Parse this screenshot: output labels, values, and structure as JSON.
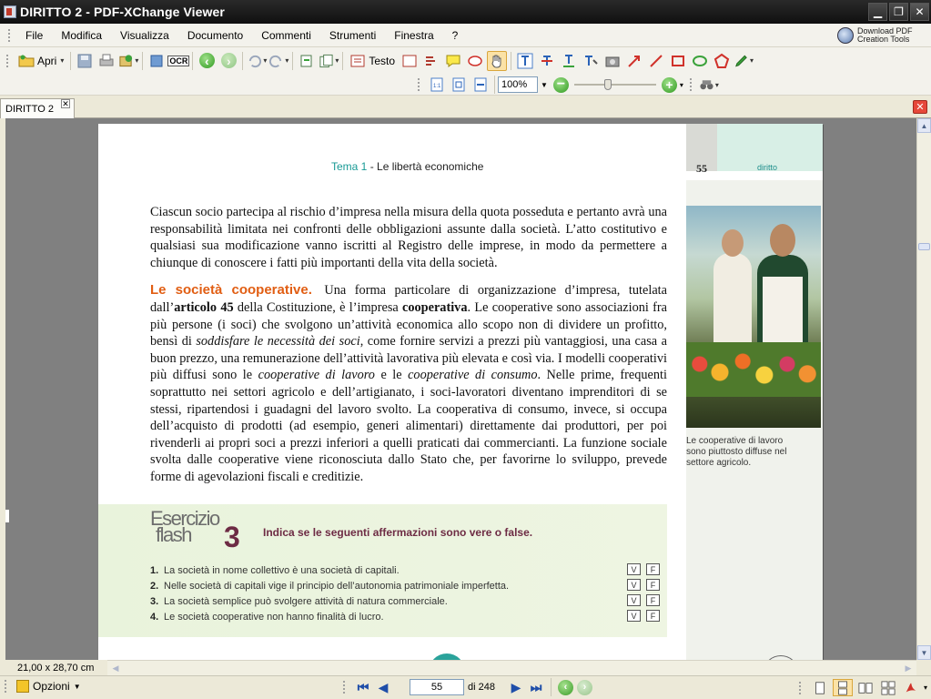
{
  "window": {
    "title": "DIRITTO 2 - PDF-XChange Viewer",
    "minimize": "▁",
    "restore": "❐",
    "close": "✕"
  },
  "menu": {
    "items": [
      "File",
      "Modifica",
      "Visualizza",
      "Documento",
      "Commenti",
      "Strumenti",
      "Finestra",
      "?"
    ]
  },
  "download": {
    "line1": "Download PDF",
    "line2": "Creation Tools"
  },
  "toolbar": {
    "open_label": "Apri",
    "ocr_label": "OCR",
    "text_label": "Testo",
    "zoom_value": "100%"
  },
  "tab": {
    "label": "DIRITTO 2",
    "close": "✕"
  },
  "page": {
    "header_tema": "Tema 1",
    "header_rest": " - Le libertà economiche",
    "page_number": "55",
    "section": "diritto",
    "para1": "Ciascun socio partecipa al rischio d’impresa nella misura della quota posseduta e pertanto avrà una responsabilità limitata nei confronti delle obbligazioni assunte dalla società. L’atto costitutivo e qualsiasi sua modificazione vanno iscritti al Registro delle imprese, in modo da permettere a chiunque di conoscere i fatti più importanti della vita della società.",
    "subhead": "Le società cooperative.",
    "para2_a": "Una forma particolare di organizzazione d’impresa, tutelata dall’",
    "para2_b": "articolo 45",
    "para2_c": " della Costituzione, è l’impresa ",
    "para2_d": "cooperativa",
    "para2_e": ". Le cooperative sono associazioni fra più persone (i soci) che svolgono un’attività economica allo scopo non di dividere un profitto, bensì di ",
    "para2_f": "soddisfare le necessità dei soci",
    "para2_g": ", come fornire servizi a prezzi più vantaggiosi, una casa a buon prezzo, una remunerazione dell’attività lavorativa più elevata e così via. I modelli cooperativi più diffusi sono le ",
    "para2_h": "cooperative di lavoro",
    "para2_i": " e le ",
    "para2_j": "cooperative di consumo",
    "para2_k": ". Nelle prime, frequenti soprattutto nei settori agricolo e dell’artigianato, i soci-lavoratori diventano imprenditori di se stessi, ripartendosi i guadagni del lavoro svolto. La cooperativa di consumo, invece, si occupa dell’acquisto di prodotti (ad esempio, generi alimentari) direttamente dai produttori, per poi rivenderli ai propri soci a prezzi inferiori a quelli praticati dai commercianti. La funzione sociale svolta dalle cooperative viene riconosciuta dallo Stato che, per favorirne lo sviluppo, prevede forme di agevolazioni fiscali e creditizie.",
    "caption": "Le cooperative di lavoro sono piuttosto diffuse nel settore agricolo.",
    "exercise": {
      "title1": "Esercizio",
      "title2": "flash",
      "number": "3",
      "instruction": "Indica se le seguenti affermazioni sono vere o false.",
      "v": "V",
      "f": "F",
      "items": [
        {
          "n": "1.",
          "text": "La società in nome collettivo è una società di capitali."
        },
        {
          "n": "2.",
          "text": "Nelle società di capitali vige il principio dell’autonomia patrimoniale imperfetta."
        },
        {
          "n": "3.",
          "text": "La società semplice può svolgere attività di natura commerciale."
        },
        {
          "n": "4.",
          "text": "Le società cooperative non hanno finalità di lucro."
        }
      ]
    }
  },
  "status": {
    "page_size": "21,00 x 28,70 cm",
    "options_label": "Opzioni",
    "current_page": "55",
    "of_pages": "di 248"
  }
}
